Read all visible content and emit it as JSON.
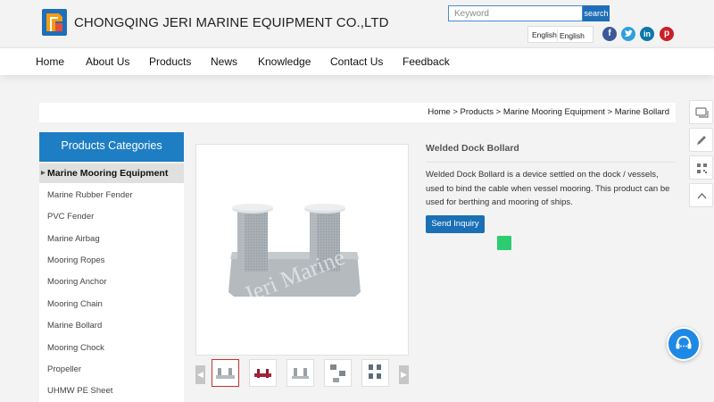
{
  "header": {
    "company_name": "CHONGQING JERI MARINE EQUIPMENT CO.,LTD",
    "search_placeholder": "Keyword",
    "search_button": "search",
    "language_primary": "English",
    "language_selected": "English",
    "social": {
      "facebook": "f",
      "twitter_icon": "twitter-bird-icon",
      "linkedin": "in",
      "pinterest": "p"
    }
  },
  "nav": {
    "items": [
      "Home",
      "About Us",
      "Products",
      "News",
      "Knowledge",
      "Contact Us",
      "Feedback"
    ]
  },
  "breadcrumb": "Home > Products > Marine Mooring Equipment > Marine Bollard",
  "sidebar": {
    "heading": "Products Categories",
    "items": [
      "Marine Mooring Equipment",
      "Marine Rubber Fender",
      "PVC Fender",
      "Marine Airbag",
      "Mooring Ropes",
      "Mooring Anchor",
      "Mooring Chain",
      "Marine Bollard",
      "Mooring Chock",
      "Propeller",
      "UHMW PE Sheet"
    ],
    "active_index": 0
  },
  "product": {
    "title": "Welded Dock Bollard",
    "description": "Welded Dock Bollard is a device settled on the dock / vessels, used to bind the cable when vessel mooring. This product can be used for berthing and mooring of ships.",
    "inquiry_button": "Send Inquiry",
    "watermark": "Jeri Marine",
    "thumbnail_count": 5,
    "selected_thumbnail": 0
  },
  "colors": {
    "brand_blue": "#1e7ec4",
    "button_blue": "#1a6fb5",
    "green_badge": "#2ecc71",
    "thumb_selected_border": "#c9302c"
  },
  "side_tools": [
    "chat-bubbles-icon",
    "pencil-icon",
    "qr-code-icon",
    "chevron-up-icon"
  ]
}
